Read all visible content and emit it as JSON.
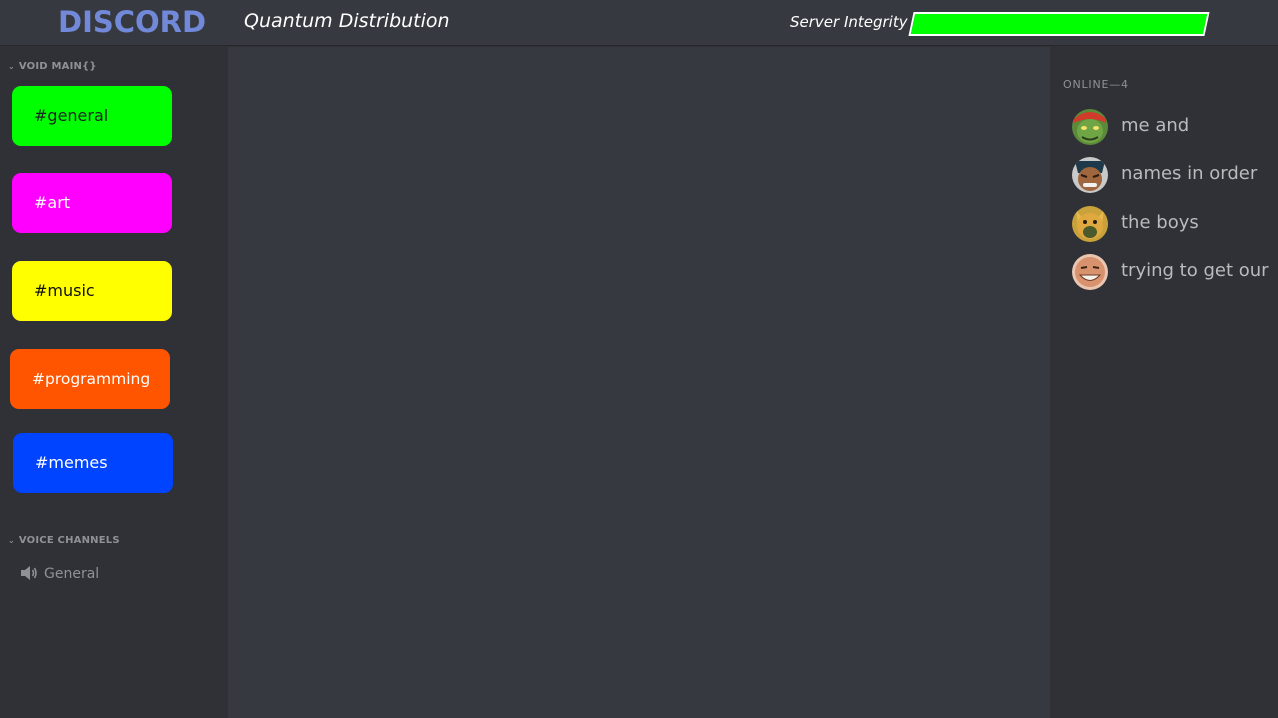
{
  "header": {
    "logo_text": "DISCORD",
    "server_name": "Quantum Distribution",
    "integrity_label": "Server Integrity",
    "integrity_level": 1.0,
    "integrity_color": "#00ff00"
  },
  "sidebar": {
    "text_category": "VOID MAIN{}",
    "channels": [
      {
        "label": "#general",
        "color": "#00ff00"
      },
      {
        "label": "#art",
        "color": "#ff00ff"
      },
      {
        "label": "#music",
        "color": "#ffff00"
      },
      {
        "label": "#programming",
        "color": "#ff5500"
      },
      {
        "label": "#memes",
        "color": "#0044ff"
      }
    ],
    "voice_category": "VOICE CHANNELS",
    "voice_channels": [
      {
        "label": "General",
        "icon": "speaker-icon"
      }
    ]
  },
  "members": {
    "header": "ONLINE—4",
    "list": [
      {
        "name": "me and",
        "avatar": "green-goblin-avatar"
      },
      {
        "name": "names in order",
        "avatar": "dark-haired-man-avatar"
      },
      {
        "name": "the boys",
        "avatar": "yellow-cat-avatar"
      },
      {
        "name": "trying to get our",
        "avatar": "smiling-man-avatar"
      }
    ]
  },
  "colors": {
    "brand": "#7289da",
    "sidebar_bg": "#2f3136",
    "chat_bg": "#36393f"
  }
}
